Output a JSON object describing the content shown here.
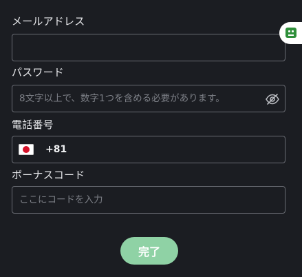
{
  "email": {
    "label": "メールアドレス",
    "value": "",
    "placeholder": ""
  },
  "password": {
    "label": "パスワード",
    "value": "",
    "placeholder": "8文字以上で、数字1つを含める必要があります。"
  },
  "phone": {
    "label": "電話番号",
    "country_code": "+81",
    "country_flag": "japan-flag-icon",
    "value": ""
  },
  "bonus_code": {
    "label": "ボーナスコード",
    "value": "",
    "placeholder": "ここにコードを入力"
  },
  "submit_label": "完了",
  "icons": {
    "password_toggle": "eye-slash-icon",
    "helper": "robot-icon"
  },
  "colors": {
    "background": "#1b1d22",
    "border": "#6a6d74",
    "button": "#8fd2a5",
    "helper_icon": "#2f8f3a"
  }
}
